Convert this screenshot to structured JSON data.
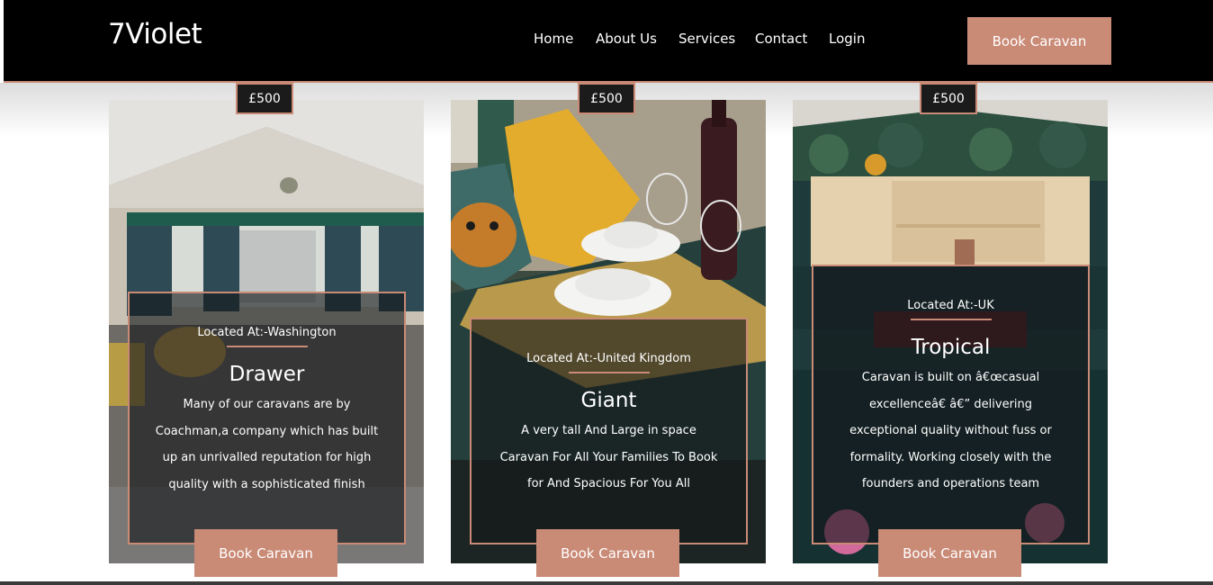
{
  "header": {
    "logo": "7Violet",
    "nav": [
      "Home",
      "About Us",
      "Services",
      "Contact",
      "Login"
    ],
    "book_button": "Book Caravan"
  },
  "colors": {
    "accent": "#c98a76",
    "header_bg": "#000000"
  },
  "cards": [
    {
      "price": "£500",
      "location": "Located At:-Washington",
      "name": "Drawer",
      "description": "Many of our caravans are by Coachman,a company which has built up an unrivalled reputation for high quality with a sophisticated finish",
      "button": "Book Caravan"
    },
    {
      "price": "£500",
      "location": "Located At:-United Kingdom",
      "name": "Giant",
      "description": "A very tall And Large in space Caravan For All Your Families To Book for And Spacious For You All",
      "button": "Book Caravan"
    },
    {
      "price": "£500",
      "location": "Located At:-UK",
      "name": "Tropical",
      "description": "Caravan is built on â€œcasual excellenceâ€  â€” delivering exceptional quality without fuss or formality. Working closely with the founders and operations team",
      "button": "Book Caravan"
    }
  ]
}
